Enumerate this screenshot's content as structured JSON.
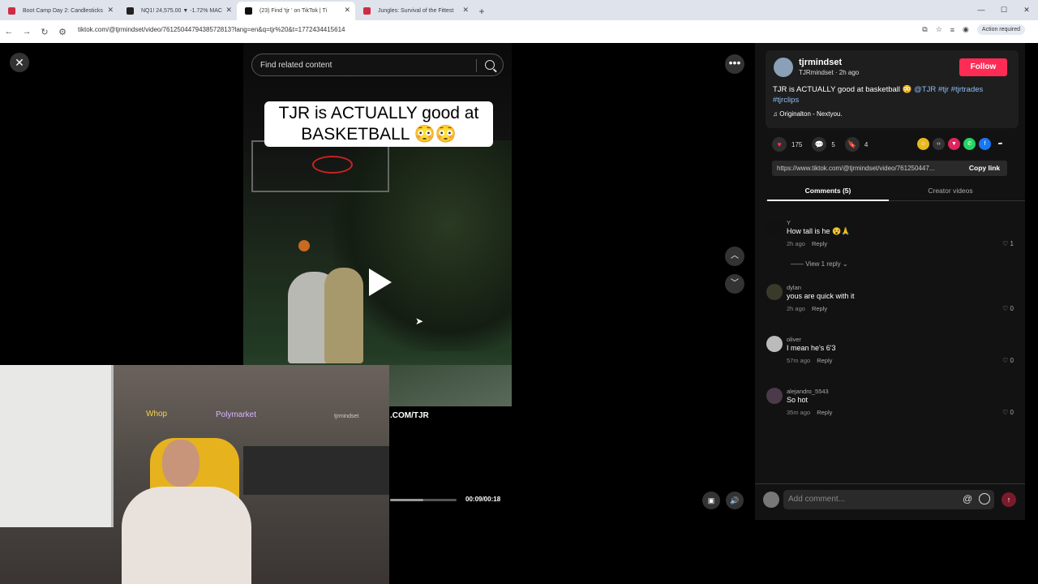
{
  "browser": {
    "tabs": [
      {
        "title": "Boot Camp Day 2: Candlesticks",
        "color": "#d12a44"
      },
      {
        "title": "NQ1! 24,575.00 ▼ -1.72% MAC",
        "color": "#222"
      },
      {
        "title": "(23) Find 'tjr ' on TikTok | Ti",
        "color": "#111"
      },
      {
        "title": "Jungles: Survival of the Fittest",
        "color": "#d12a44"
      }
    ],
    "url": "tiktok.com/@tjrmindset/video/7612504479438572813?lang=en&q=tjr%20&t=1772434415614",
    "action_required": "Action required"
  },
  "viewer": {
    "search_placeholder": "Find related content",
    "caption": "TJR is ACTUALLY good at BASKETBALL 😳😳",
    "overlay_text": ".COM/TJR",
    "time": "00:09/00:18",
    "progress": 0.5,
    "webcam_signs": [
      "Whop",
      "Polymarket",
      "tjrmindset"
    ]
  },
  "post": {
    "username": "tjrmindset",
    "subline": "TJRmindset · 2h ago",
    "follow_label": "Follow",
    "description": "TJR is ACTUALLY good at basketball 😳",
    "tags": "@TJR #tjr #tjrtrades #tjrclips",
    "music": "♫  Originalton - Nextyou.",
    "likes": "175",
    "comments": "5",
    "saves": "4",
    "link": "https://www.tiktok.com/@tjrmindset/video/761250447...",
    "copy_link": "Copy link",
    "tab_comments": "Comments (5)",
    "tab_creator": "Creator videos"
  },
  "comments": [
    {
      "user": "Y",
      "text": "How tall is he 😵🙏",
      "time": "2h ago",
      "reply": "Reply",
      "likes": "1"
    },
    {
      "user": "dylan",
      "text": "yous are quick with it",
      "time": "2h ago",
      "reply": "Reply",
      "likes": "0"
    },
    {
      "user": "oliver",
      "text": "I mean he's 6'3",
      "time": "57m ago",
      "reply": "Reply",
      "likes": "0"
    },
    {
      "user": "alejandro_5543",
      "text": "So hot",
      "time": "35m ago",
      "reply": "Reply",
      "likes": "0"
    }
  ],
  "view_replies": "View 1 reply",
  "add_comment_placeholder": "Add comment...",
  "colors": {
    "accent": "#fe2c55",
    "tag": "#8fbef5"
  }
}
